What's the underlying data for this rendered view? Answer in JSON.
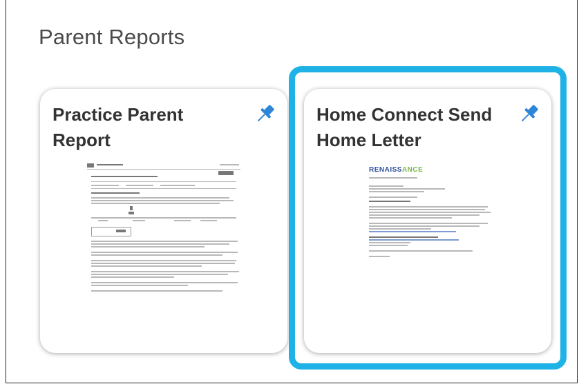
{
  "section": {
    "title": "Parent Reports"
  },
  "cards": [
    {
      "title": "Practice Parent Report",
      "pin_icon": "pin-icon",
      "selected": false
    },
    {
      "title": "Home Connect Send Home Letter",
      "pin_icon": "pin-icon",
      "selected": true,
      "thumb_logo_main": "RENAISS",
      "thumb_logo_accent": "ANCE"
    }
  ],
  "colors": {
    "accent": "#1fb2e6",
    "pin": "#2e86d9",
    "title": "#333333"
  }
}
